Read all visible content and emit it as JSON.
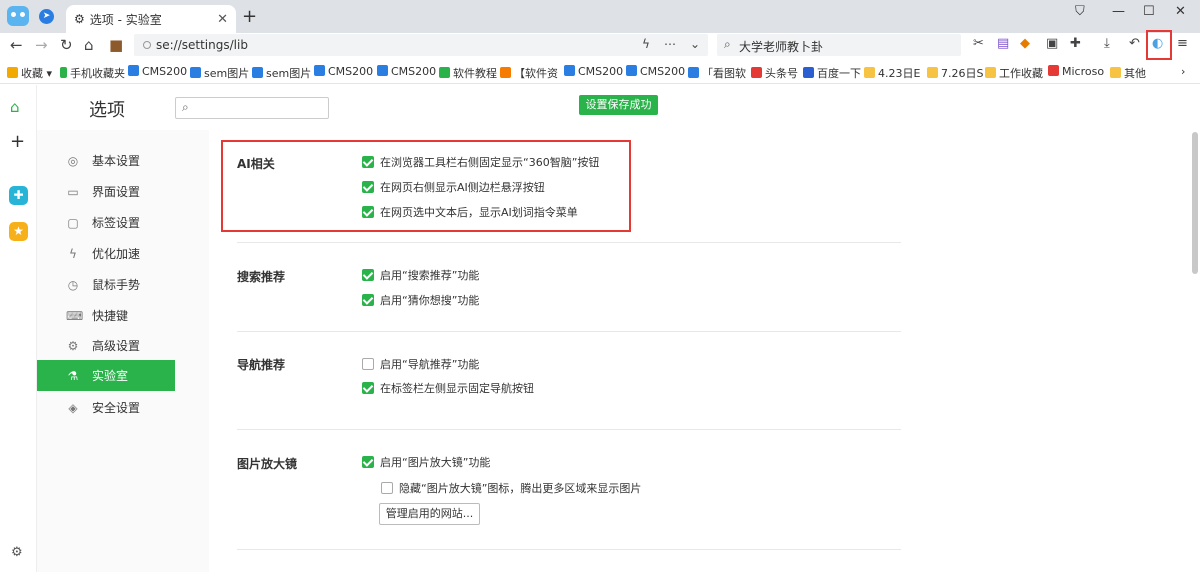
{
  "browser": {
    "tab_title": "选项 - 实验室",
    "tab_close": "✕",
    "new_tab": "+",
    "window_controls": [
      "⛉",
      "—",
      "☐",
      "✕"
    ],
    "url": "se://settings/lib",
    "search_text": "大学老师教卜卦",
    "toolbar_icons": [
      "back-icon",
      "forward-icon",
      "reload-icon",
      "home-icon",
      "briefcase-icon"
    ]
  },
  "bookmarks": [
    {
      "label": "收藏",
      "color": "#f2a900"
    },
    {
      "label": "手机收藏夹",
      "color": "#29b34a"
    },
    {
      "label": "CMS200",
      "color": "#2a7de1"
    },
    {
      "label": "sem图片",
      "color": "#2a7de1"
    },
    {
      "label": "sem图片",
      "color": "#2a7de1"
    },
    {
      "label": "CMS200",
      "color": "#2a7de1"
    },
    {
      "label": "CMS200",
      "color": "#2a7de1"
    },
    {
      "label": "软件教程",
      "color": "#29b34a"
    },
    {
      "label": "【软件资",
      "color": "#f57c00"
    },
    {
      "label": "CMS200",
      "color": "#2a7de1"
    },
    {
      "label": "CMS200",
      "color": "#2a7de1"
    },
    {
      "label": "「看图软",
      "color": "#2a7de1"
    },
    {
      "label": "头条号",
      "color": "#e53935"
    },
    {
      "label": "百度一下",
      "color": "#2a5ed1"
    },
    {
      "label": "4.23日E",
      "color": "#f6c343"
    },
    {
      "label": "7.26日S",
      "color": "#f6c343"
    },
    {
      "label": "工作收藏",
      "color": "#f6c343"
    },
    {
      "label": "Microso",
      "color": "#e53935"
    },
    {
      "label": "其他",
      "color": "#f6c343"
    }
  ],
  "settings": {
    "title": "选项",
    "search_placeholder": "",
    "save_status": "设置保存成功",
    "nav": [
      {
        "label": "基本设置",
        "icon": "◎"
      },
      {
        "label": "界面设置",
        "icon": "▭"
      },
      {
        "label": "标签设置",
        "icon": "▢"
      },
      {
        "label": "优化加速",
        "icon": "ϟ"
      },
      {
        "label": "鼠标手势",
        "icon": "◷"
      },
      {
        "label": "快捷键",
        "icon": "⌨"
      },
      {
        "label": "高级设置",
        "icon": "⚙"
      },
      {
        "label": "实验室",
        "icon": "⚗"
      },
      {
        "label": "安全设置",
        "icon": "◈"
      }
    ],
    "active_nav": "实验室",
    "sections": [
      {
        "title": "AI相关",
        "options": [
          {
            "label": "在浏览器工具栏右侧固定显示“360智脑”按钮",
            "checked": true
          },
          {
            "label": "在网页右侧显示AI侧边栏悬浮按钮",
            "checked": true
          },
          {
            "label": "在网页选中文本后，显示AI划词指令菜单",
            "checked": true
          }
        ]
      },
      {
        "title": "搜索推荐",
        "options": [
          {
            "label": "启用“搜索推荐”功能",
            "checked": true
          },
          {
            "label": "启用“猜你想搜”功能",
            "checked": true
          }
        ]
      },
      {
        "title": "导航推荐",
        "options": [
          {
            "label": "启用“导航推荐”功能",
            "checked": false
          },
          {
            "label": "在标签栏左侧显示固定导航按钮",
            "checked": true
          }
        ]
      },
      {
        "title": "图片放大镜",
        "options": [
          {
            "label": "启用“图片放大镜”功能",
            "checked": true
          },
          {
            "label": "隐藏“图片放大镜”图标，腾出更多区域来显示图片",
            "checked": false
          }
        ],
        "button": "管理启用的网站..."
      }
    ]
  },
  "colors": {
    "accent": "#29b34a",
    "highlight_border": "#e53935"
  }
}
